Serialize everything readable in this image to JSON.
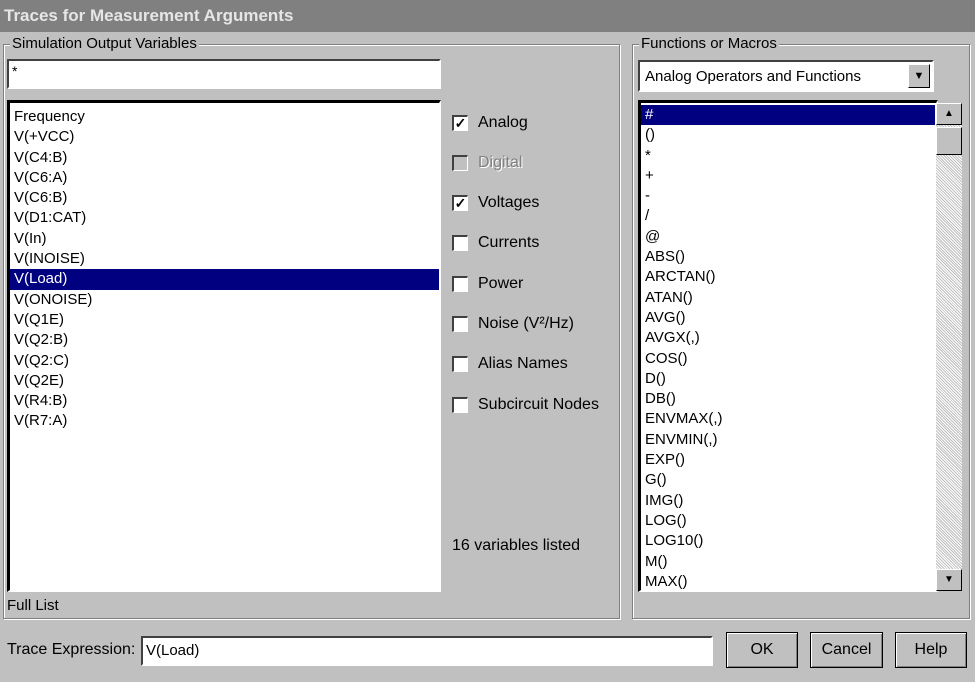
{
  "window": {
    "title": "Traces for Measurement Arguments"
  },
  "output_variables": {
    "group_label": "Simulation Output Variables",
    "filter_value": "*",
    "items": [
      "Frequency",
      "V(+VCC)",
      "V(C4:B)",
      "V(C6:A)",
      "V(C6:B)",
      "V(D1:CAT)",
      "V(In)",
      "V(INOISE)",
      "V(Load)",
      "V(ONOISE)",
      "V(Q1E)",
      "V(Q2:B)",
      "V(Q2:C)",
      "V(Q2E)",
      "V(R4:B)",
      "V(R7:A)"
    ],
    "selected_index": 8,
    "footer": "Full List"
  },
  "filters": {
    "analog": {
      "label": "Analog",
      "checked": true,
      "enabled": true
    },
    "digital": {
      "label": "Digital",
      "checked": false,
      "enabled": false
    },
    "voltages": {
      "label": "Voltages",
      "checked": true,
      "enabled": true
    },
    "currents": {
      "label": "Currents",
      "checked": false,
      "enabled": true
    },
    "power": {
      "label": "Power",
      "checked": false,
      "enabled": true
    },
    "noise": {
      "label": "Noise (V²/Hz)",
      "checked": false,
      "enabled": true
    },
    "alias_names": {
      "label": "Alias Names",
      "checked": false,
      "enabled": true
    },
    "subcircuit_nodes": {
      "label": "Subcircuit Nodes",
      "checked": false,
      "enabled": true
    },
    "count_text": "16 variables listed"
  },
  "functions": {
    "group_label": "Functions or Macros",
    "selected_category": "Analog Operators and Functions",
    "items": [
      "#",
      "()",
      "*",
      "+",
      "-",
      "/",
      "@",
      "ABS()",
      "ARCTAN()",
      "ATAN()",
      "AVG()",
      "AVGX(,)",
      "COS()",
      "D()",
      "DB()",
      "ENVMAX(,)",
      "ENVMIN(,)",
      "EXP()",
      "G()",
      "IMG()",
      "LOG()",
      "LOG10()",
      "M()",
      "MAX()"
    ],
    "selected_index": 0
  },
  "trace": {
    "label": "Trace Expression:",
    "value": "V(Load)"
  },
  "buttons": {
    "ok": "OK",
    "cancel": "Cancel",
    "help": "Help"
  }
}
